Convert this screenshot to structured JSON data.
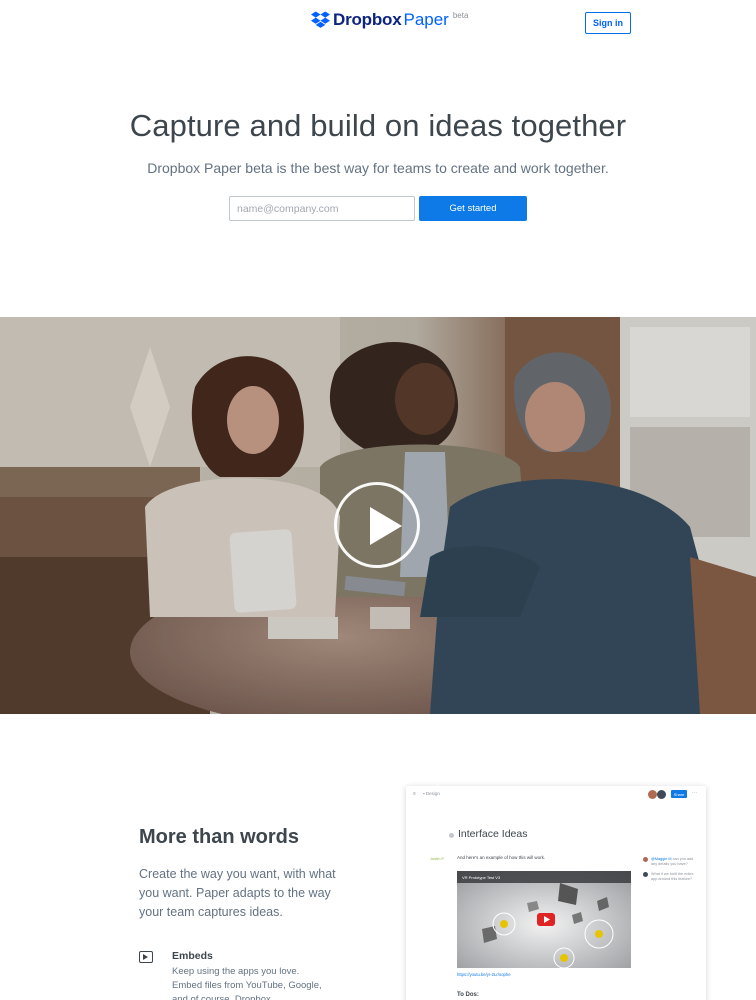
{
  "header": {
    "logo_word": "Dropbox",
    "logo_product": "Paper",
    "logo_badge": "beta",
    "signin_label": "Sign in"
  },
  "hero": {
    "title": "Capture and build on ideas together",
    "subtitle": "Dropbox Paper beta is the best way for teams to create and work together.",
    "email_placeholder": "name@company.com",
    "email_value": "",
    "cta_label": "Get started"
  },
  "video": {
    "play_icon": "play-icon"
  },
  "features": {
    "title": "More than words",
    "description": "Create the way you want, with what you want. Paper adapts to the way your team captures ideas.",
    "embeds": {
      "icon": "video-embed-icon",
      "title": "Embeds",
      "description": "Keep using the apps you love. Embed files from YouTube, Google, and of course, Dropbox."
    }
  },
  "mockup": {
    "menu_icon": "≡",
    "breadcrumb": "▪ Design",
    "share_label": "Share",
    "more_icon": "···",
    "doc_title": "Interface Ideas",
    "tag": "Justin F.",
    "line1": "And here's an example of how this will work.",
    "video_title": "VR Prototype Test V3",
    "link": "https://youtu.be/yr-2Lr/oophe",
    "todos": "To Dos:",
    "comments": [
      {
        "mention": "@Maggie M",
        "text": "can you add any details you have?"
      },
      {
        "mention": "",
        "text": "What if we built the entire app around this feature?"
      }
    ]
  },
  "colors": {
    "brand_blue": "#0061fe",
    "brand_navy": "#0d2481",
    "cta_blue": "#0d7ae8",
    "text_primary": "#3d464d",
    "text_secondary": "#637282"
  }
}
